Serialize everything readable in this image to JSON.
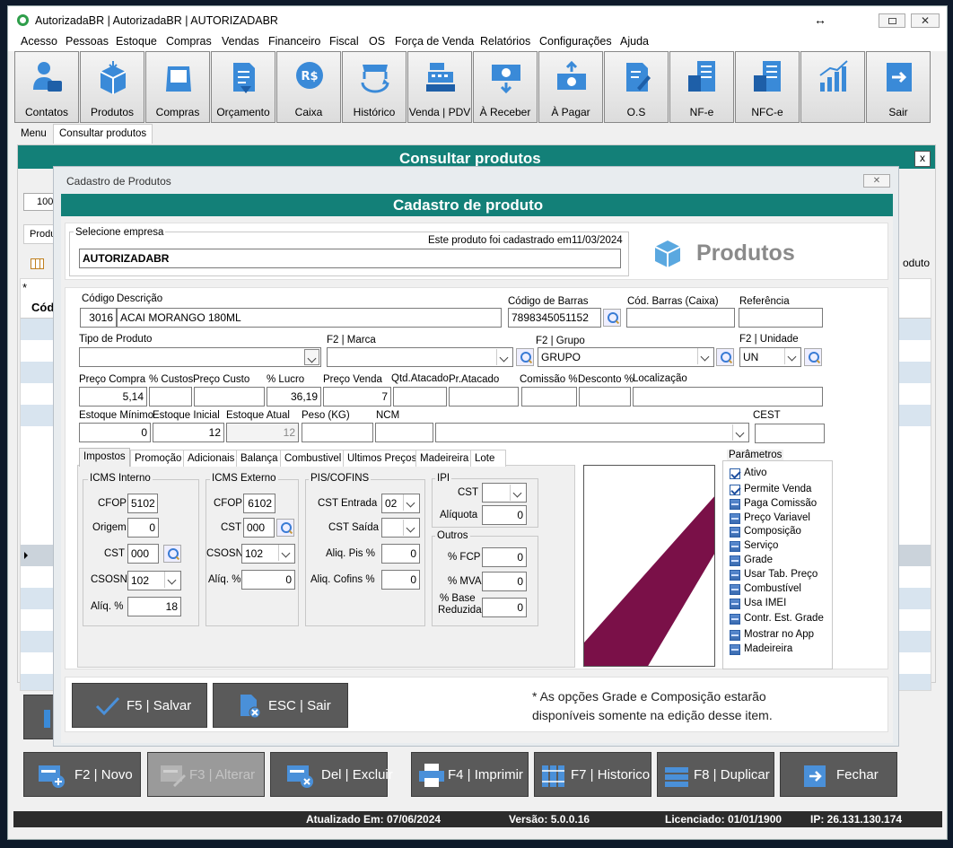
{
  "window": {
    "title": "AutorizadaBR | AutorizadaBR | AUTORIZADABR"
  },
  "menu": [
    "Acesso",
    "Pessoas",
    "Estoque",
    "Compras",
    "Vendas",
    "Financeiro",
    "Fiscal",
    "OS",
    "Força de Venda",
    "Relatórios",
    "Configurações",
    "Ajuda"
  ],
  "toolbar": [
    "Contatos",
    "Produtos",
    "Compras",
    "Orçamento",
    "Caixa",
    "Histórico",
    "Venda | PDV",
    "À Receber",
    "À Pagar",
    "O.S",
    "NF-e",
    "NFC-e",
    "",
    "Sair"
  ],
  "tabs": {
    "menu": "Menu",
    "consultar": "Consultar produtos"
  },
  "consultar": {
    "title": "Consultar produtos",
    "close": "x",
    "field_value": "100",
    "tab_partial": "Produ",
    "col_partial": "Códi",
    "right_partial": "oduto"
  },
  "dialog": {
    "window_title": "Cadastro de Produtos",
    "header": "Cadastro de produto",
    "empresa_label": "Selecione empresa",
    "cadastrado_label": "Este produto foi cadastrado em",
    "cadastrado_data": "11/03/2024",
    "empresa": "AUTORIZADABR",
    "logo_text": "Produtos",
    "labels": {
      "codigo": "Código",
      "descricao": "Descrição",
      "cod_barras": "Código de Barras",
      "cod_barras_caixa": "Cód. Barras (Caixa)",
      "referencia": "Referência",
      "tipo": "Tipo de Produto",
      "marca": "F2 | Marca",
      "grupo": "F2 | Grupo",
      "unidade": "F2 | Unidade",
      "preco_compra": "Preço Compra",
      "custos": "% Custos",
      "preco_custo": "Preço Custo",
      "lucro": "% Lucro",
      "preco_venda": "Preço Venda",
      "qtd_atacado": "Qtd.Atacado",
      "pr_atacado": "Pr.Atacado",
      "comissao": "Comissão %",
      "desconto": "Desconto %",
      "localizacao": "Localização",
      "est_min": "Estoque Mínimo",
      "est_ini": "Estoque Inicial",
      "est_atual": "Estoque Atual",
      "peso": "Peso (KG)",
      "ncm": "NCM",
      "cest": "CEST"
    },
    "values": {
      "codigo": "3016",
      "descricao": "ACAI MORANGO 180ML",
      "cod_barras": "7898345051152",
      "grupo": "GRUPO",
      "unidade": "UN",
      "preco_compra": "5,14",
      "lucro": "36,19",
      "preco_venda": "7",
      "est_min": "0",
      "est_ini": "12",
      "est_atual": "12"
    },
    "subtabs": [
      "Impostos",
      "Promoção",
      "Adicionais",
      "Balança",
      "Combustivel",
      "Ultimos Preços",
      "Madeireira",
      "Lote"
    ],
    "icms_interno": {
      "title": "ICMS Interno",
      "cfop_l": "CFOP",
      "cfop": "5102",
      "origem_l": "Origem",
      "origem": "0",
      "cst_l": "CST",
      "cst": "000",
      "csosn_l": "CSOSN",
      "csosn": "102",
      "aliq_l": "Alíq. %",
      "aliq": "18"
    },
    "icms_externo": {
      "title": "ICMS Externo",
      "cfop_l": "CFOP",
      "cfop": "6102",
      "cst_l": "CST",
      "cst": "000",
      "csosn_l": "CSOSN",
      "csosn": "102",
      "aliq_l": "Alíq. %",
      "aliq": "0"
    },
    "pis": {
      "title": "PIS/COFINS",
      "cst_ent_l": "CST Entrada",
      "cst_ent": "02",
      "cst_sai_l": "CST Saída",
      "pis_l": "Aliq. Pis %",
      "pis": "0",
      "cofins_l": "Aliq. Cofins %",
      "cofins": "0"
    },
    "ipi": {
      "title": "IPI",
      "cst_l": "CST",
      "aliq_l": "Alíquota",
      "aliq": "0"
    },
    "outros": {
      "title": "Outros",
      "fcp_l": "% FCP",
      "fcp": "0",
      "mva_l": "% MVA",
      "mva": "0",
      "base_l1": "% Base",
      "base_l2": "Reduzida",
      "base": "0"
    },
    "parametros_title": "Parâmetros",
    "parametros": [
      {
        "label": "Ativo",
        "checked": true
      },
      {
        "label": "Permite Venda",
        "checked": true
      },
      {
        "label": "Paga Comissão",
        "checked": false
      },
      {
        "label": "Preço Variavel",
        "checked": false
      },
      {
        "label": "Composição",
        "checked": false
      },
      {
        "label": "Serviço",
        "checked": false
      },
      {
        "label": "Grade",
        "checked": false
      },
      {
        "label": "Usar Tab. Preço",
        "checked": false
      },
      {
        "label": "Combustível",
        "checked": false
      },
      {
        "label": "Usa IMEI",
        "checked": false
      },
      {
        "label": "Contr. Est. Grade",
        "checked": false
      },
      {
        "label": "Mostrar no App",
        "checked": false
      },
      {
        "label": "Madeireira",
        "checked": false
      }
    ],
    "salvar": "F5 | Salvar",
    "sair": "ESC | Sair",
    "note1": "* As opções Grade e Composição estarão",
    "note2": "disponíveis somente na edição desse item."
  },
  "bottom_buttons": [
    "F2 | Novo",
    "F3 | Alterar",
    "Del | Excluir",
    "F4 | Imprimir",
    "F7 | Historico",
    "F8 | Duplicar",
    "Fechar"
  ],
  "status": {
    "atualizado": "Atualizado Em: 07/06/2024",
    "versao": "Versão: 5.0.0.16",
    "licenciado": "Licenciado: 01/01/1900",
    "ip": "IP: 26.131.130.174"
  },
  "colors": {
    "teal": "#138078",
    "dark_button": "#5a5a5a",
    "image_stripe": "#7a1048"
  }
}
